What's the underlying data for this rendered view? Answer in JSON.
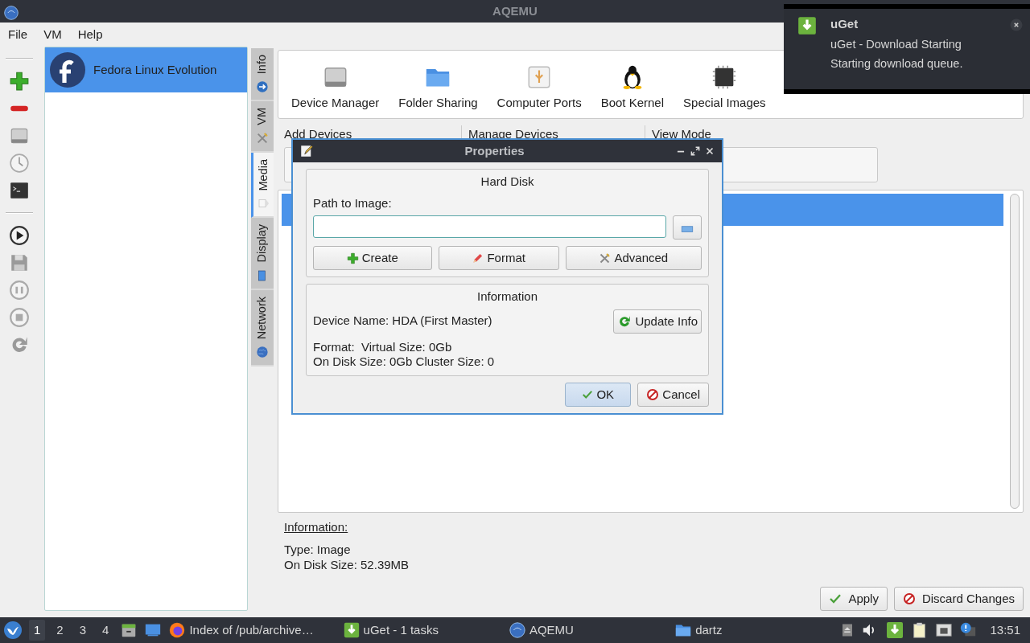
{
  "window": {
    "title": "AQEMU"
  },
  "menu": [
    "File",
    "VM",
    "Help"
  ],
  "vm_list": [
    {
      "name": "Fedora Linux Evolution",
      "selected": true
    }
  ],
  "side_tabs": [
    {
      "label": "Info",
      "selected": false
    },
    {
      "label": "VM",
      "selected": false
    },
    {
      "label": "Media",
      "selected": true
    },
    {
      "label": "Display",
      "selected": false
    },
    {
      "label": "Network",
      "selected": false
    }
  ],
  "device_tools": [
    "Device Manager",
    "Folder Sharing",
    "Computer Ports",
    "Boot Kernel",
    "Special Images"
  ],
  "groups": [
    "Add Devices",
    "Manage Devices",
    "View Mode"
  ],
  "device_list": {
    "rows": [
      {
        "selected": true
      }
    ]
  },
  "information": {
    "heading": "Information:",
    "lines": [
      "Type: Image",
      "On Disk Size: 52.39MB"
    ]
  },
  "buttons": [
    {
      "label": "Apply",
      "kind": "apply"
    },
    {
      "label": "Discard Changes",
      "kind": "discard"
    }
  ],
  "dialog": {
    "title": "Properties",
    "hard_disk": {
      "title": "Hard Disk",
      "path_label": "Path to Image:",
      "buttons": [
        {
          "label": "Create",
          "kind": "create"
        },
        {
          "label": "Format",
          "kind": "format"
        },
        {
          "label": "Advanced",
          "kind": "advanced"
        }
      ]
    },
    "information": {
      "title": "Information",
      "device_name": "Device Name: HDA (First Master)",
      "update_button": "Update Info",
      "lines": [
        "Format:  Virtual Size: 0Gb",
        "On Disk Size: 0Gb Cluster Size: 0"
      ]
    },
    "buttons": [
      {
        "label": "OK",
        "kind": "ok",
        "default": true
      },
      {
        "label": "Cancel",
        "kind": "cancel",
        "default": false
      }
    ]
  },
  "notification": {
    "app": "uGet",
    "title": "uGet - Download Starting",
    "body": "Starting download queue."
  },
  "taskbar": {
    "workspaces": [
      {
        "label": "1",
        "selected": true
      },
      {
        "label": "2",
        "selected": false
      },
      {
        "label": "3",
        "selected": false
      },
      {
        "label": "4",
        "selected": false
      }
    ],
    "tasks": [
      {
        "label": "Index of /pub/archive…",
        "kind": "browser"
      },
      {
        "label": "uGet - 1 tasks",
        "kind": "uget"
      },
      {
        "label": "AQEMU",
        "kind": "aqemu"
      },
      {
        "label": "dartz",
        "kind": "folder"
      }
    ],
    "clock": "13:51"
  }
}
